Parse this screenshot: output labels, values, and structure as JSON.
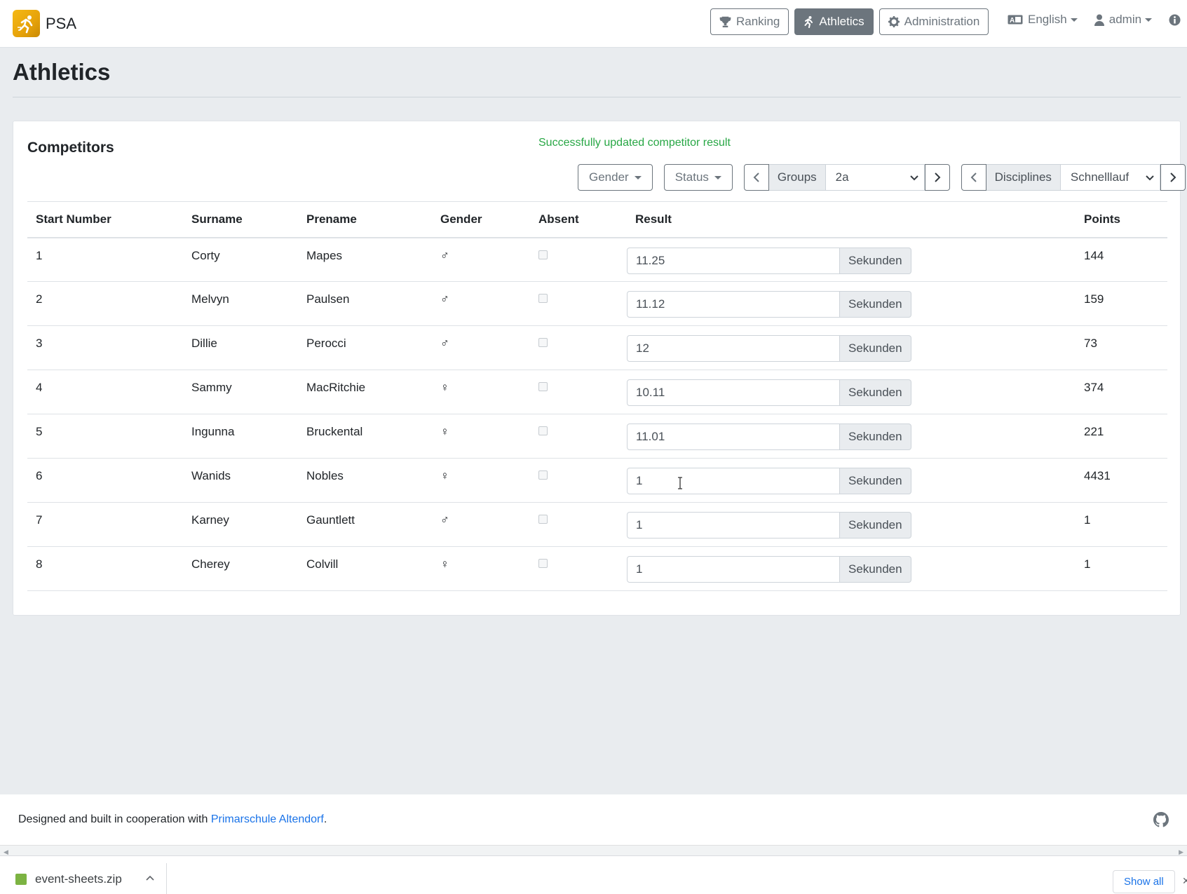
{
  "brand": {
    "name": "PSA"
  },
  "nav": {
    "ranking": "Ranking",
    "athletics": "Athletics",
    "administration": "Administration",
    "language": "English",
    "user": "admin"
  },
  "page": {
    "title": "Athletics"
  },
  "card": {
    "title": "Competitors",
    "success": "Successfully updated competitor result"
  },
  "filters": {
    "gender": "Gender",
    "status": "Status",
    "groups_label": "Groups",
    "group_value": "2a",
    "disciplines_label": "Disciplines",
    "discipline_value": "Schnelllauf"
  },
  "table": {
    "headers": [
      "Start Number",
      "Surname",
      "Prename",
      "Gender",
      "Absent",
      "Result",
      "Points"
    ],
    "unit": "Sekunden",
    "rows": [
      {
        "start": "1",
        "surname": "Corty",
        "prename": "Mapes",
        "gender": "♂",
        "result": "11.25",
        "points": "144"
      },
      {
        "start": "2",
        "surname": "Melvyn",
        "prename": "Paulsen",
        "gender": "♂",
        "result": "11.12",
        "points": "159"
      },
      {
        "start": "3",
        "surname": "Dillie",
        "prename": "Perocci",
        "gender": "♂",
        "result": "12",
        "points": "73"
      },
      {
        "start": "4",
        "surname": "Sammy",
        "prename": "MacRitchie",
        "gender": "♀",
        "result": "10.11",
        "points": "374"
      },
      {
        "start": "5",
        "surname": "Ingunna",
        "prename": "Bruckental",
        "gender": "♀",
        "result": "11.01",
        "points": "221"
      },
      {
        "start": "6",
        "surname": "Wanids",
        "prename": "Nobles",
        "gender": "♀",
        "result": "1",
        "points": "4431"
      },
      {
        "start": "7",
        "surname": "Karney",
        "prename": "Gauntlett",
        "gender": "♂",
        "result": "1",
        "points": "1"
      },
      {
        "start": "8",
        "surname": "Cherey",
        "prename": "Colvill",
        "gender": "♀",
        "result": "1",
        "points": "1"
      }
    ]
  },
  "footer": {
    "text": "Designed and built in cooperation with ",
    "link": "Primarschule Altendorf",
    "period": "."
  },
  "downloads": {
    "file": "event-sheets.zip",
    "show_all": "Show all"
  }
}
